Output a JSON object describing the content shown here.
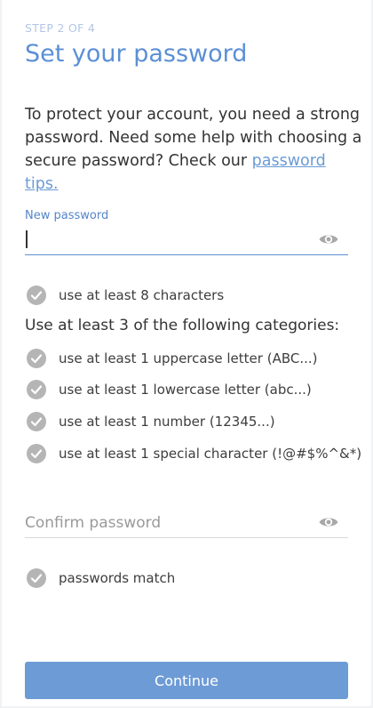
{
  "step_label": "STEP 2 OF 4",
  "title": "Set your password",
  "intro": {
    "text": "To protect your account, you need a strong password. Need some help with choosing a secure password? Check our ",
    "link_text": "password tips."
  },
  "new_password": {
    "label": "New password",
    "value": ""
  },
  "requirement_min_length": "use at least 8 characters",
  "categories_heading": "Use at least 3 of the following categories:",
  "categories": [
    "use at least 1 uppercase letter (ABC...)",
    "use at least 1 lowercase letter (abc...)",
    "use at least 1 number (12345...)",
    "use at least 1 special character (!@#$%^&*)"
  ],
  "confirm_password": {
    "placeholder": "Confirm password",
    "value": ""
  },
  "match_label": "passwords match",
  "continue_label": "Continue",
  "icons": {
    "eye": "eye-icon",
    "check": "check-circle-icon"
  },
  "colors": {
    "accent": "#5b8fd6",
    "button": "#6d9bd6",
    "check_icon": "#b5b5b5",
    "eye_icon": "#a8a8a8"
  }
}
